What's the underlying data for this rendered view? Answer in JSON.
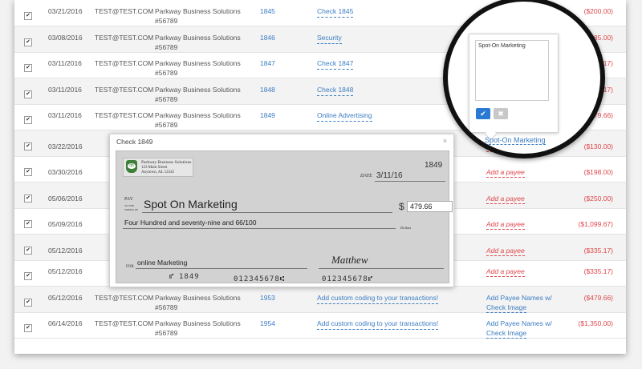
{
  "rows": [
    {
      "checked": true,
      "date": "03/21/2016",
      "email": "TEST@TEST.COM",
      "payee_line1": "Parkway Business Solutions",
      "payee_line2": "#56789",
      "number": "1845",
      "memo": "Check 1845",
      "payee_action": "Add a payee",
      "payee_action_line2": "",
      "payee_type": "add",
      "amount": "($200.00)"
    },
    {
      "checked": true,
      "date": "03/08/2016",
      "email": "TEST@TEST.COM",
      "payee_line1": "Parkway Business Solutions",
      "payee_line2": "#56789",
      "number": "1846",
      "memo": "Security",
      "payee_action": "",
      "payee_action_line2": "",
      "payee_type": "none",
      "amount": "($685.00)"
    },
    {
      "checked": true,
      "date": "03/11/2016",
      "email": "TEST@TEST.COM",
      "payee_line1": "Parkway Business Solutions",
      "payee_line2": "#56789",
      "number": "1847",
      "memo": "Check 1847",
      "payee_action": "",
      "payee_action_line2": "",
      "payee_type": "none",
      "amount": "($35.17)"
    },
    {
      "checked": true,
      "date": "03/11/2016",
      "email": "TEST@TEST.COM",
      "payee_line1": "Parkway Business Solutions",
      "payee_line2": "#56789",
      "number": "1848",
      "memo": "Check 1848",
      "payee_action": "",
      "payee_action_line2": "",
      "payee_type": "none",
      "amount": "($35.17)"
    },
    {
      "checked": true,
      "date": "03/11/2016",
      "email": "TEST@TEST.COM",
      "payee_line1": "Parkway Business Solutions",
      "payee_line2": "#56789",
      "number": "1849",
      "memo": "Online Advertising",
      "payee_action": "",
      "payee_action_line2": "",
      "payee_type": "none",
      "amount": "($479.66)"
    },
    {
      "checked": true,
      "date": "03/22/2016",
      "email": "",
      "payee_line1": "",
      "payee_line2": "",
      "number": "",
      "memo": "",
      "payee_action": "Add a payee",
      "payee_action_line2": "",
      "payee_type": "add",
      "amount": "($130.00)"
    },
    {
      "checked": true,
      "date": "03/30/2016",
      "email": "",
      "payee_line1": "",
      "payee_line2": "",
      "number": "",
      "memo": "",
      "payee_action": "Add a payee",
      "payee_action_line2": "",
      "payee_type": "add",
      "amount": "($198.00)"
    },
    {
      "checked": true,
      "date": "05/06/2016",
      "email": "",
      "payee_line1": "",
      "payee_line2": "",
      "number": "",
      "memo": "",
      "payee_action": "Add a payee",
      "payee_action_line2": "",
      "payee_type": "add",
      "amount": "($250.00)"
    },
    {
      "checked": true,
      "date": "05/09/2016",
      "email": "",
      "payee_line1": "",
      "payee_line2": "",
      "number": "",
      "memo": "",
      "payee_action": "Add a payee",
      "payee_action_line2": "",
      "payee_type": "add",
      "amount": "($1,099.67)"
    },
    {
      "checked": true,
      "date": "05/12/2016",
      "email": "",
      "payee_line1": "",
      "payee_line2": "",
      "number": "",
      "memo": "",
      "payee_action": "Add a payee",
      "payee_action_line2": "",
      "payee_type": "add",
      "amount": "($335.17)"
    },
    {
      "checked": true,
      "date": "05/12/2016",
      "email": "",
      "payee_line1": "",
      "payee_line2": "#56789",
      "number": "",
      "memo": "",
      "payee_action": "Add a payee",
      "payee_action_line2": "",
      "payee_type": "add",
      "amount": "($335.17)"
    },
    {
      "checked": true,
      "date": "05/12/2016",
      "email": "TEST@TEST.COM",
      "payee_line1": "Parkway Business Solutions",
      "payee_line2": "#56789",
      "number": "1953",
      "memo": "Add custom coding to your transactions!",
      "payee_action": "Add Payee Names w/",
      "payee_action_line2": "Check Image",
      "payee_type": "blue",
      "amount": "($479.66)"
    },
    {
      "checked": true,
      "date": "06/14/2016",
      "email": "TEST@TEST.COM",
      "payee_line1": "Parkway Business Solutions",
      "payee_line2": "#56789",
      "number": "1954",
      "memo": "Add custom coding to your transactions!",
      "payee_action": "Add Payee Names w/",
      "payee_action_line2": "Check Image",
      "payee_type": "blue",
      "amount": "($1,350.00)"
    }
  ],
  "check_modal": {
    "title": "Check 1849",
    "close_icon": "×",
    "company_name": "Parkway Business Solutions",
    "company_address1": "123 Main Street",
    "company_address2": "Anytown, AL 12345",
    "logo_text": "qb",
    "check_number": "1849",
    "date_label": "DATE",
    "date_value": "3/11/16",
    "pay_label": "PAY",
    "pay_sub_label1": "TO THE",
    "pay_sub_label2": "ORDER OF",
    "payee": "Spot On Marketing",
    "dollar_sign": "$",
    "amount": "479.66",
    "amount_words": "Four Hundred and seventy-nine and 66/100",
    "dollars_label": "Dollars",
    "for_label": "FOR",
    "memo": "online Marketing",
    "signature": "Matthew",
    "micr_check_number": "1849",
    "micr_routing": "012345678⑆",
    "micr_account": "012345678⑈"
  },
  "magnifier": {
    "textarea_value": "Spot-On Marketing",
    "ok_icon": "✔",
    "cancel_icon": "✖",
    "payee_link": "Spot-On Marketing"
  },
  "icons": {
    "checkbox": "checkbox-icon"
  }
}
